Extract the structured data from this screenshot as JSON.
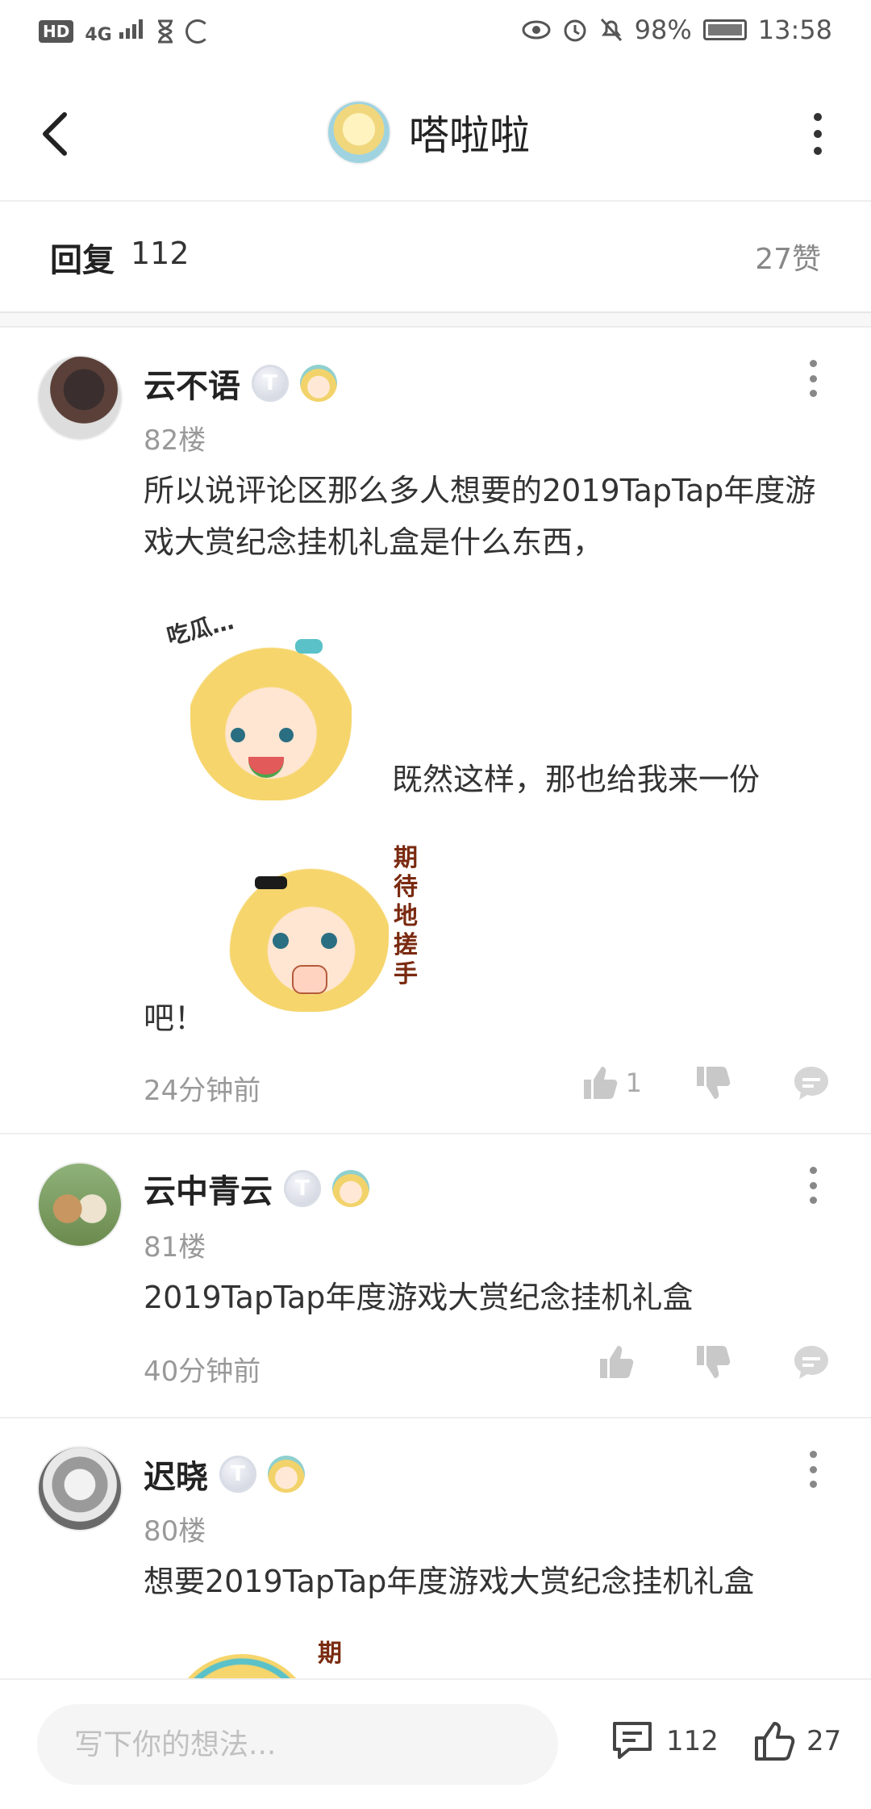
{
  "status_bar": {
    "left_badge": "HD",
    "network": "4G",
    "battery": "98%",
    "time": "13:58"
  },
  "header": {
    "title": "嗒啦啦"
  },
  "reply_header": {
    "label": "回复",
    "count": "112",
    "likes": "27赞"
  },
  "comments": [
    {
      "name": "云不语",
      "badge": "T",
      "floor": "82楼",
      "text_1": "所以说评论区那么多人想要的2019TapTap年度游戏大赏纪念挂机礼盒是什么东西，",
      "text_2": "既然这样，那也给我来一份",
      "text_3": "吧！",
      "sticker_1_text": "吃瓜…",
      "sticker_2_text": "期待地搓手",
      "time": "24分钟前",
      "likes": "1"
    },
    {
      "name": "云中青云",
      "badge": "T",
      "floor": "81楼",
      "text_1": "2019TapTap年度游戏大赏纪念挂机礼盒",
      "time": "40分钟前",
      "likes": ""
    },
    {
      "name": "迟晓",
      "badge": "T",
      "floor": "80楼",
      "text_1": "想要2019TapTap年度游戏大赏纪念挂机礼盒",
      "sticker_text": "期"
    }
  ],
  "bottom_bar": {
    "input_placeholder": "写下你的想法...",
    "comment_count": "112",
    "like_count": "27"
  }
}
